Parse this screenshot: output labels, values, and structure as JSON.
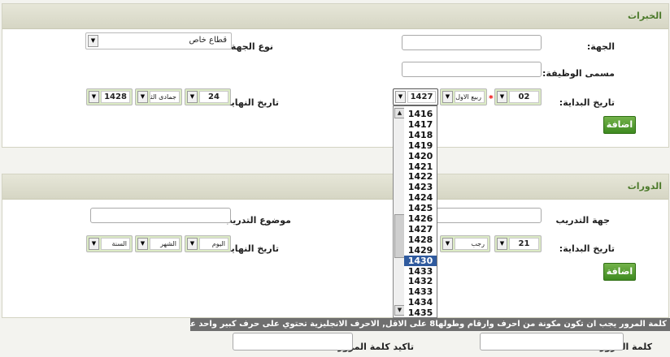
{
  "experience": {
    "title": "الخبرات",
    "entity_label": "الجهة:",
    "job_title_label": "مسمى الوظيفة:",
    "start_date_label": "تاريخ البداية:",
    "sector_label": "نوع الجهة:",
    "sector_value": "قطاع خاص",
    "end_date_label": "تاريخ النهاية:",
    "start_day": "02",
    "start_month": "ربيع الاول",
    "start_year": "1427",
    "end_day": "24",
    "end_month": "جمادى الثاني",
    "end_year": "1428",
    "add_button": "اضافة"
  },
  "courses": {
    "title": "الدورات",
    "training_entity_label": "جهة التدريب",
    "training_topic_label": "موضوع التدريب",
    "start_date_label": "تاريخ البداية:",
    "end_date_label": "تاريخ النهاية:",
    "start_day": "21",
    "start_month": "رجب",
    "end_day": "اليوم",
    "end_month": "الشهر",
    "end_year": "السنة",
    "add_button": "اضافة"
  },
  "year_list": {
    "items": [
      "1416",
      "1417",
      "1418",
      "1419",
      "1420",
      "1421",
      "1422",
      "1423",
      "1424",
      "1425",
      "1426",
      "1427",
      "1428",
      "1429",
      "1430",
      "1433",
      "1432",
      "1433",
      "1434",
      "1435"
    ],
    "highlighted": "1430"
  },
  "password": {
    "notice": "كلمة المرور يجب ان تكون مكونة من احرف وارقام وطولها8 على الاقل, الاحرف الانجليزية تحتوي على حرف كبير واحد على الاقل",
    "password_label": "كلمة المرور",
    "confirm_label": "تاكيد كلمة المرور"
  }
}
